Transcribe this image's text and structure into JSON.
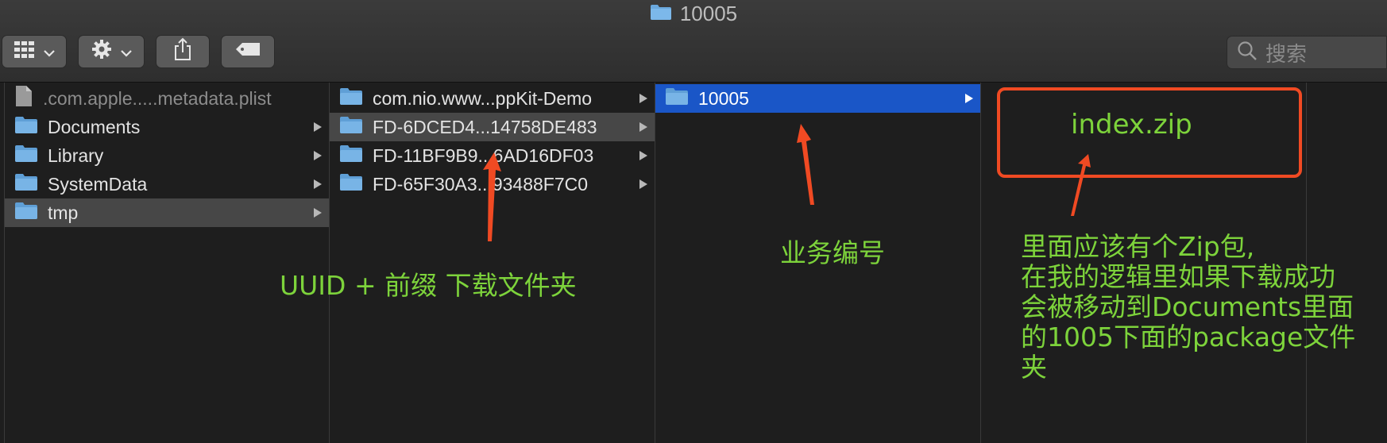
{
  "window": {
    "title": "10005",
    "title_icon": "folder-icon"
  },
  "toolbar": {
    "view_button_icon": "grid-view-icon",
    "action_button_icon": "gear-icon",
    "share_button_icon": "share-icon",
    "tag_button_icon": "tag-icon",
    "search_placeholder": "搜索"
  },
  "columns": [
    {
      "items": [
        {
          "label": ".com.apple.....metadata.plist",
          "icon": "document-icon",
          "has_children": false,
          "state": "dim"
        },
        {
          "label": "Documents",
          "icon": "folder-icon",
          "has_children": true,
          "state": "normal"
        },
        {
          "label": "Library",
          "icon": "folder-icon",
          "has_children": true,
          "state": "normal"
        },
        {
          "label": "SystemData",
          "icon": "folder-icon",
          "has_children": true,
          "state": "normal"
        },
        {
          "label": "tmp",
          "icon": "folder-icon",
          "has_children": true,
          "state": "selected"
        }
      ]
    },
    {
      "items": [
        {
          "label": "com.nio.www...ppKit-Demo",
          "icon": "folder-icon",
          "has_children": true,
          "state": "normal"
        },
        {
          "label": "FD-6DCED4...14758DE483",
          "icon": "folder-icon",
          "has_children": true,
          "state": "selected"
        },
        {
          "label": "FD-11BF9B9...6AD16DF03",
          "icon": "folder-icon",
          "has_children": true,
          "state": "normal"
        },
        {
          "label": "FD-65F30A3...93488F7C0",
          "icon": "folder-icon",
          "has_children": true,
          "state": "normal"
        }
      ]
    },
    {
      "items": [
        {
          "label": "10005",
          "icon": "folder-icon",
          "has_children": true,
          "state": "active"
        }
      ]
    },
    {
      "items": []
    },
    {
      "items": []
    }
  ],
  "annotations": {
    "uuid_note": "UUID + 前缀 下载文件夹",
    "business_id_note": "业务编号",
    "expected_file": "index.zip",
    "explanation_lines": [
      "里面应该有个Zip包,",
      "在我的逻辑里如果下载成功",
      "会被移动到Documents里面",
      "的1005下面的package文件",
      "夹"
    ],
    "text_color": "#7dd33b",
    "highlight_color": "#f04a23"
  },
  "colors": {
    "selection_active": "#1a56c7",
    "selection_inactive": "#474747",
    "folder": "#6aa8dd"
  }
}
